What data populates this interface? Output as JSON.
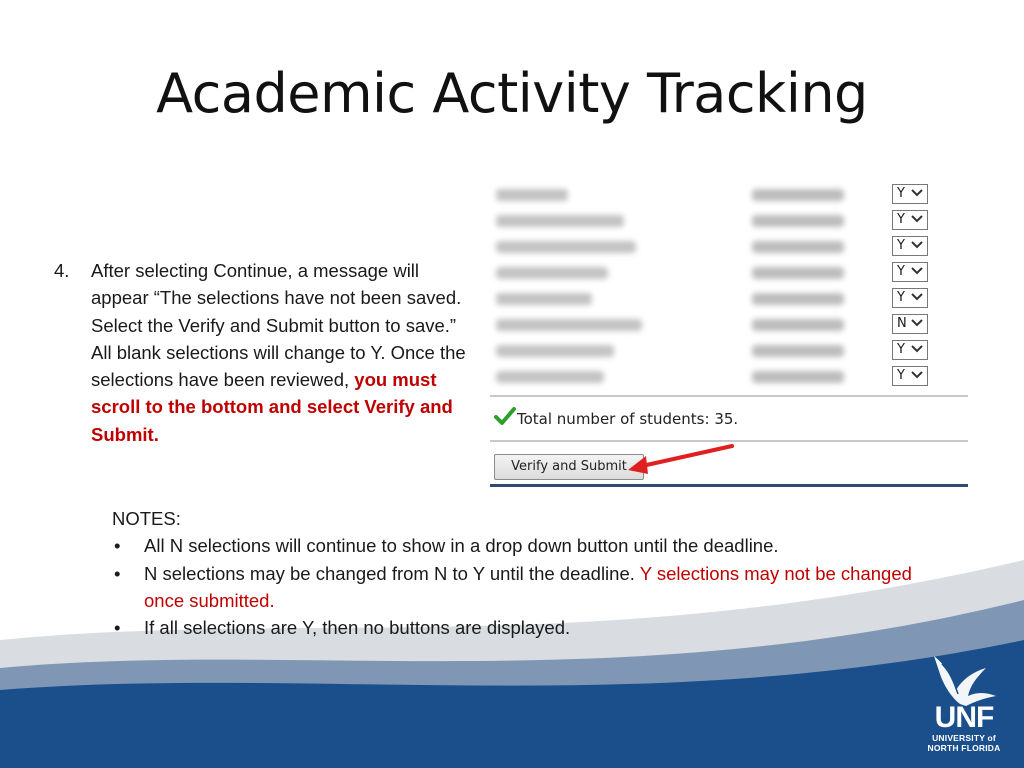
{
  "title": "Academic Activity Tracking",
  "step": {
    "number": "4.",
    "text_before": "After selecting Continue, a message will appear “The selections have not been saved. Select the Verify and Submit button to save.” All blank selections will change to Y. Once the selections have been reviewed, ",
    "text_emphasis": "you must scroll to the bottom and select Verify and Submit."
  },
  "screenshot": {
    "selections": [
      "Y",
      "Y",
      "Y",
      "Y",
      "Y",
      "N",
      "Y",
      "Y"
    ],
    "total_label": "Total number of students: 35.",
    "verify_button_label": "Verify and Submit"
  },
  "notes": {
    "heading": "NOTES:",
    "bullet": "•",
    "item1": "All N selections will continue to show in a drop down button until the deadline.",
    "item2_plain": "N selections may be changed from N to Y until the deadline. ",
    "item2_red": "Y selections may not be changed once submitted.",
    "item3": "If all selections are Y, then no buttons are displayed."
  },
  "logo": {
    "abbr": "UNF",
    "line1": "UNIVERSITY of",
    "line2": "NORTH FLORIDA"
  },
  "colors": {
    "emphasis_red": "#c00000",
    "brand_blue": "#1b4f8c",
    "arrow_red": "#e02020",
    "check_green": "#2e9e2e"
  },
  "icons": [
    "checkmark-icon",
    "chevron-down-icon",
    "red-arrow-icon",
    "osprey-logo-icon"
  ]
}
